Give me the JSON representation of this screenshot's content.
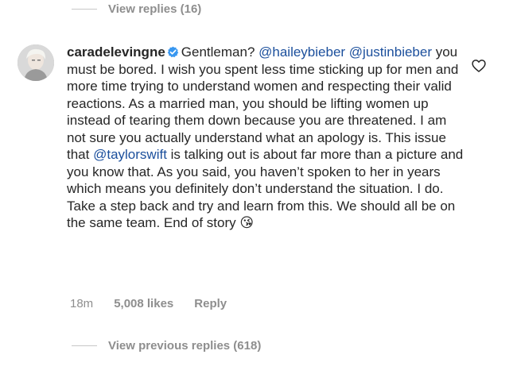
{
  "top_replies": {
    "label": "View replies (16)"
  },
  "comment": {
    "username": "caradelevingne",
    "segments": [
      {
        "text": "Gentleman? ",
        "mention": false
      },
      {
        "text": "@haileybieber",
        "mention": true
      },
      {
        "text": " ",
        "mention": false
      },
      {
        "text": "@justinbieber",
        "mention": true
      },
      {
        "text": " you must be bored. I wish you spent less time sticking up for men and more time trying to understand women and respecting their valid reactions. As a married man, you should be lifting women up instead of tearing them down because you are threatened. I am not sure you actually understand what an apology is. This issue that ",
        "mention": false
      },
      {
        "text": "@taylorswift",
        "mention": true
      },
      {
        "text": " is talking out is about far more than a picture and you know that. As you said, you haven’t spoken to her in years which means you definitely don’t understand the situation. I do. Take a step back and try and learn from this. We should all be on the same team. End of story ",
        "mention": false
      },
      {
        "text": "😘",
        "mention": false
      }
    ],
    "time": "18m",
    "likes": "5,008 likes",
    "reply_label": "Reply"
  },
  "bottom_replies": {
    "label": "View previous replies (618)"
  },
  "icons": {
    "verified": "verified-badge-icon",
    "heart": "heart-outline-icon"
  },
  "colors": {
    "text": "#262626",
    "secondary": "#8e8e8e",
    "mention": "#1b4f9c",
    "verified": "#3897f0"
  }
}
